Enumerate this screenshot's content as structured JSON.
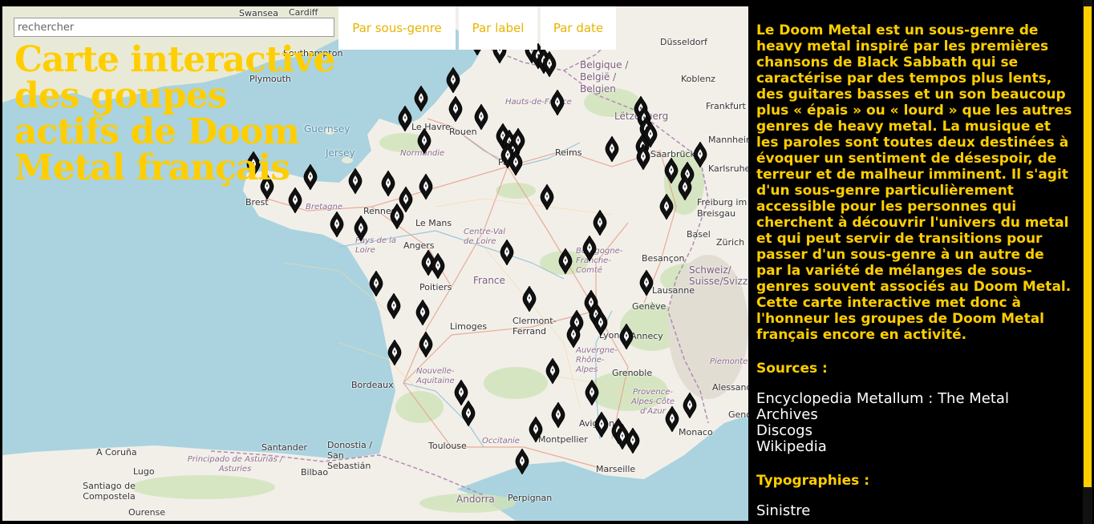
{
  "search": {
    "placeholder": "rechercher"
  },
  "filters": [
    {
      "label": "Par sous-genre"
    },
    {
      "label": "Par label"
    },
    {
      "label": "Par date"
    }
  ],
  "title": "Carte interactive des goupes actifs de Doom Metal français",
  "panel": {
    "intro": "Le Doom Metal est un sous-genre de heavy metal inspiré par les premières chansons de Black Sabbath qui se caractérise par des tempos plus lents, des guitares basses et un son beaucoup plus « épais » ou « lourd » que les autres genres de heavy metal. La musique et les paroles sont toutes deux destinées à évoquer un sentiment de désespoir, de terreur et de malheur imminent. Il s'agit d'un sous-genre particulièrement accessible pour les personnes qui cherchent à découvrir l'univers du metal et qui peut servir de transitions pour passer d'un sous-genre à un autre de par la variété de mélanges de sous-genres souvent associés au Doom Metal. Cette carte interactive met donc à l'honneur les groupes de Doom Metal français encore en activité.",
    "sources_heading": "Sources :",
    "sources": [
      "Encyclopedia Metallum : The Metal Archives",
      "Discogs",
      "Wikipedia"
    ],
    "typo_heading": "Typographies :",
    "typos": [
      "Sinistre"
    ]
  },
  "map": {
    "places": {
      "swansea": "Swansea",
      "cardiff": "Cardiff",
      "southampton": "Southampton",
      "plymouth": "Plymouth",
      "guernsey": "Guernsey",
      "jersey": "Jersey",
      "brest": "Brest",
      "bretagne": "Bretagne",
      "rennes": "Rennes",
      "le_mans": "Le Mans",
      "angers": "Angers",
      "normandie": "Normandie",
      "le_havre": "Le Havre",
      "rouen": "Rouen",
      "hauts_de_france": "Hauts-de-France",
      "paris": "Paris",
      "reims": "Reims",
      "belgique": "Belgique / België / Belgien",
      "dusseldorf": "Düsseldorf",
      "koblenz": "Koblenz",
      "frankfurt": "Frankfurt",
      "letzebuerg": "Lëtzebuerg",
      "saarbrucken": "Saarbrücken",
      "mannheim": "Mannheim",
      "karlsruhe": "Karlsruhe",
      "freiburg": "Freiburg im Breisgau",
      "basel": "Basel",
      "zurich": "Zürich",
      "schweiz": "Schweiz/ Suisse/Svizzera",
      "besancon": "Besançon",
      "centre_val_de_loire": "Centre-Val de Loire",
      "france": "France",
      "pays_de_la_loire": "Pays de la Loire",
      "poitiers": "Poitiers",
      "limoges": "Limoges",
      "clermont": "Clermont-Ferrand",
      "lyon": "Lyon",
      "annecy": "Annecy",
      "geneve": "Genève",
      "lausanne": "Lausanne",
      "grenoble": "Grenoble",
      "auvergne": "Auvergne-Rhône-Alpes",
      "bordeaux": "Bordeaux",
      "nouvelle_aquitaine": "Nouvelle-Aquitaine",
      "toulouse": "Toulouse",
      "occitanie": "Occitanie",
      "montpellier": "Montpellier",
      "avignon": "Avignon",
      "marseille": "Marseille",
      "provence": "Provence-Alpes-Côte d'Azur",
      "monaco": "Monaco",
      "genova": "Genova",
      "alessandria": "Alessandria",
      "piemonte": "Piemonte",
      "perpignan": "Perpignan",
      "andorra": "Andorra",
      "santander": "Santander",
      "donostia": "Donostia / San Sebastián",
      "bilbao": "Bilbao",
      "lugo": "Lugo",
      "a_coruna": "A Coruña",
      "asturias": "Principado de Asturias / Asturies",
      "santiago": "Santiago de Compostela",
      "ourense": "Ourense",
      "bourgogne": "Bourgogne-Franche-Comté"
    }
  }
}
